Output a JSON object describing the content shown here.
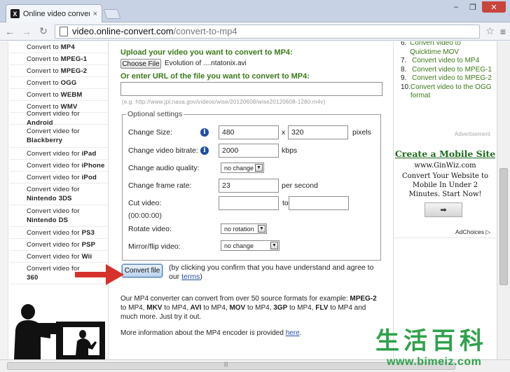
{
  "browser": {
    "tab_title": "Online video converter to",
    "tab_close": "×",
    "url_host": "video.online-convert.com",
    "url_path": "/convert-to-mp4",
    "window_buttons": [
      "–",
      "❐",
      "✕"
    ]
  },
  "left_menu": [
    {
      "prefix": "Convert to ",
      "format": "MP4"
    },
    {
      "prefix": "Convert to ",
      "format": "MPEG-1"
    },
    {
      "prefix": "Convert to ",
      "format": "MPEG-2"
    },
    {
      "prefix": "Convert to ",
      "format": "OGG"
    },
    {
      "prefix": "Convert to ",
      "format": "WEBM"
    },
    {
      "prefix": "Convert to ",
      "format": "WMV"
    },
    {
      "prefix": "Convert video for ",
      "format": "Android"
    },
    {
      "prefix": "Convert video for",
      "format": "Blackberry"
    },
    {
      "prefix": "Convert video for ",
      "format": "iPad"
    },
    {
      "prefix": "Convert video for ",
      "format": "iPhone"
    },
    {
      "prefix": "Convert video for ",
      "format": "iPod"
    },
    {
      "prefix": "Convert video for",
      "format": "Nintendo 3DS"
    },
    {
      "prefix": "Convert video for",
      "format": "Nintendo DS"
    },
    {
      "prefix": "Convert video for ",
      "format": "PS3"
    },
    {
      "prefix": "Convert video for ",
      "format": "PSP"
    },
    {
      "prefix": "Convert video for ",
      "format": "Wii"
    },
    {
      "prefix": "Convert video for",
      "format": "360"
    }
  ],
  "upload": {
    "heading": "Upload your video you want to convert to MP4:",
    "choose_label": "Choose File",
    "file_name": "Evolution of ....ntatonix.avi",
    "url_heading": "Or enter URL of the file you want to convert to MP4:",
    "url_value": "",
    "example": "(e.g. http://www.jpl.nasa.gov/videos/wise/20120608/wise20120608-1280.m4v)"
  },
  "settings": {
    "legend": "Optional settings",
    "size_label": "Change Size:",
    "width": "480",
    "times": "x",
    "height": "320",
    "pixels": "pixels",
    "bitrate_label": "Change video bitrate:",
    "bitrate": "2000",
    "kbps": "kbps",
    "audio_label": "Change audio quality:",
    "audio_value": "no change",
    "framerate_label": "Change frame rate:",
    "framerate": "23",
    "per_second": "per second",
    "cut_label": "Cut video:",
    "cut_format": "(00:00:00)",
    "cut_to": "to",
    "cut_from_value": "",
    "cut_to_value": "",
    "rotate_label": "Rotate video:",
    "rotate_value": "no rotation",
    "mirror_label": "Mirror/flip video:",
    "mirror_value": "no change",
    "info_glyph": "i",
    "dropdown_glyph": "▼"
  },
  "convert": {
    "button": "Convert file",
    "agree_text": "(by clicking you confirm that you have understand and agree to our ",
    "terms": "terms",
    "agree_end": ")"
  },
  "description": {
    "p1": "Our MP4 converter can convert from over 50 source formats for example: ",
    "f1": "MPEG-2",
    "t1": " to MP4, ",
    "f2": "MKV",
    "t2": " to MP4, ",
    "f3": "AVI",
    "t3": " to MP4, ",
    "f4": "MOV",
    "t4": " to MP4, ",
    "f5": "3GP",
    "t5": " to MP4, ",
    "f6": "FLV",
    "t6": " to MP4 and much more. Just try it out.",
    "more_text": "More information about the MP4 encoder is provided ",
    "here": "here",
    "more_end": "."
  },
  "right_list": [
    {
      "num": "6.",
      "text": "Convert video to Quicktime MOV"
    },
    {
      "num": "7.",
      "text": "Convert video to MP4"
    },
    {
      "num": "8.",
      "text": "Convert video to MPEG-1"
    },
    {
      "num": "9.",
      "text": "Convert video to MPEG-2"
    },
    {
      "num": "10.",
      "text": "Convert video to the OGG format"
    }
  ],
  "ad": {
    "label": "Advertisement",
    "title": "Create a Mobile Site",
    "domain": "www.GinWiz.com",
    "body": "Convert Your Website to Mobile In Under 2 Minutes. Start Now!",
    "button_glyph": "➡",
    "adchoices": "AdChoices ▷"
  },
  "watermark": {
    "chars": [
      "生",
      "活",
      "百",
      "科"
    ],
    "url": "www.bimeiz.com"
  },
  "colors": {
    "green_heading": "#3a7a18",
    "link_blue": "#1f4fa0",
    "arrow_red": "#d6322b",
    "watermark_green": "#2ea24a"
  }
}
